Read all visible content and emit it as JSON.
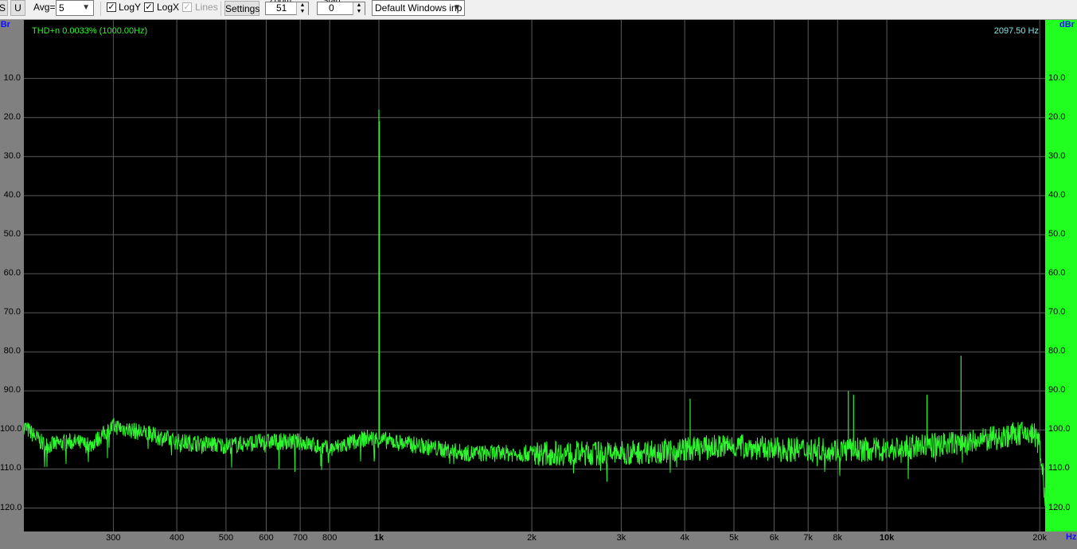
{
  "toolbar": {
    "s_label": "S",
    "u_label": "U",
    "avg_label": "Avg=",
    "avg_value": "5",
    "logy_label": "LogY",
    "logy_checked": true,
    "logx_label": "LogX",
    "logx_checked": true,
    "lines_label": "Lines",
    "lines_checked": true,
    "settings_label": "Settings",
    "zoom_label": "Zoom",
    "zoom_value": "51",
    "start_label": "Start",
    "start_value": "0",
    "input_device": "Default Windows inp"
  },
  "overlay": {
    "thd_text": "THD+n 0.0033% (1000.00Hz)",
    "freq_readout": "2097.50 Hz"
  },
  "colors": {
    "trace": "#2ef52e",
    "grid": "#5a5a5a",
    "plot_bg": "#000000",
    "right_panel": "#21ff21",
    "unit_text": "#1010ff",
    "readout": "#7fe7e7"
  },
  "chart_data": {
    "type": "line",
    "ylabel": "dBr",
    "xlabel": "Hz",
    "xscale": "log",
    "xlim": [
      200,
      20500
    ],
    "ylim": [
      -126,
      5
    ],
    "y_ticks": [
      "10.0",
      "20.0",
      "30.0",
      "40.0",
      "50.0",
      "60.0",
      "70.0",
      "80.0",
      "90.0",
      "100.0",
      "110.0",
      "120.0"
    ],
    "y_tick_values": [
      -10,
      -20,
      -30,
      -40,
      -50,
      -60,
      -70,
      -80,
      -90,
      -100,
      -110,
      -120
    ],
    "x_ticks": [
      {
        "label": "300",
        "value": 300,
        "bold": false
      },
      {
        "label": "400",
        "value": 400,
        "bold": false
      },
      {
        "label": "500",
        "value": 500,
        "bold": false
      },
      {
        "label": "600",
        "value": 600,
        "bold": false
      },
      {
        "label": "700",
        "value": 700,
        "bold": false
      },
      {
        "label": "800",
        "value": 800,
        "bold": false
      },
      {
        "label": "1k",
        "value": 1000,
        "bold": true
      },
      {
        "label": "2k",
        "value": 2000,
        "bold": false
      },
      {
        "label": "3k",
        "value": 3000,
        "bold": false
      },
      {
        "label": "4k",
        "value": 4000,
        "bold": false
      },
      {
        "label": "5k",
        "value": 5000,
        "bold": false
      },
      {
        "label": "6k",
        "value": 6000,
        "bold": false
      },
      {
        "label": "7k",
        "value": 7000,
        "bold": false
      },
      {
        "label": "8k",
        "value": 8000,
        "bold": false
      },
      {
        "label": "10k",
        "value": 10000,
        "bold": true
      },
      {
        "label": "20k",
        "value": 20000,
        "bold": false
      }
    ],
    "grid": true,
    "series": [
      {
        "noise_floor": [
          [
            200,
            -99
          ],
          [
            220,
            -104
          ],
          [
            250,
            -103
          ],
          [
            270,
            -104
          ],
          [
            300,
            -99
          ],
          [
            350,
            -101
          ],
          [
            400,
            -103
          ],
          [
            500,
            -104
          ],
          [
            600,
            -103
          ],
          [
            700,
            -103
          ],
          [
            800,
            -105
          ],
          [
            950,
            -102
          ],
          [
            1200,
            -104
          ],
          [
            1500,
            -106
          ],
          [
            2000,
            -106
          ],
          [
            3000,
            -106
          ],
          [
            4000,
            -105
          ],
          [
            5000,
            -104
          ],
          [
            6000,
            -105
          ],
          [
            7000,
            -105
          ],
          [
            8000,
            -105
          ],
          [
            10000,
            -105
          ],
          [
            12000,
            -104
          ],
          [
            15000,
            -103
          ],
          [
            18000,
            -101
          ],
          [
            19500,
            -101
          ],
          [
            20000,
            -104
          ],
          [
            20300,
            -110
          ],
          [
            20500,
            -122
          ]
        ],
        "peaks": [
          {
            "x": 1000,
            "y": -18
          },
          {
            "x": 1002,
            "y": -21
          },
          {
            "x": 4100,
            "y": -92
          },
          {
            "x": 8400,
            "y": -90
          },
          {
            "x": 8600,
            "y": -91
          },
          {
            "x": 12000,
            "y": -91
          },
          {
            "x": 14000,
            "y": -81
          }
        ]
      }
    ]
  }
}
